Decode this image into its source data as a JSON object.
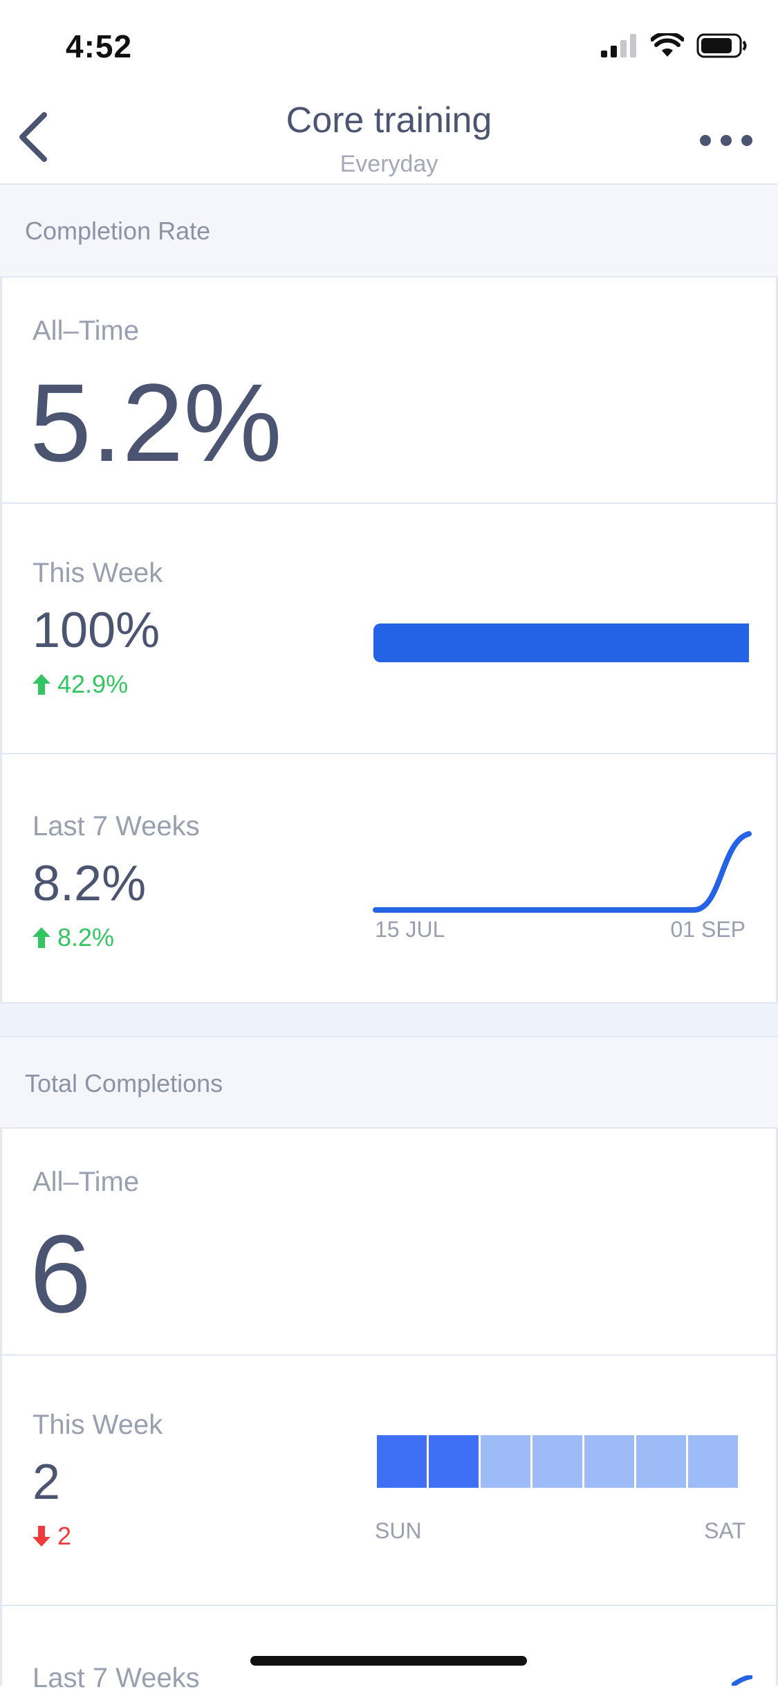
{
  "status_bar": {
    "time": "4:52"
  },
  "nav": {
    "title": "Core training",
    "subtitle": "Everyday"
  },
  "completion_rate": {
    "header": "Completion Rate",
    "all_time": {
      "label": "All–Time",
      "value": "5.2%"
    },
    "this_week": {
      "label": "This Week",
      "value": "100%",
      "delta": "42.9%",
      "delta_direction": "up",
      "bar_fill": 1.0
    },
    "last_7_weeks": {
      "label": "Last 7 Weeks",
      "value": "8.2%",
      "delta": "8.2%",
      "delta_direction": "up",
      "axis_start": "15 JUL",
      "axis_end": "01 SEP"
    }
  },
  "total_completions": {
    "header": "Total Completions",
    "all_time": {
      "label": "All–Time",
      "value": "6"
    },
    "this_week": {
      "label": "This Week",
      "value": "2",
      "delta": "2",
      "delta_direction": "down",
      "axis_start": "SUN",
      "axis_end": "SAT",
      "days_completed": [
        true,
        true,
        false,
        false,
        false,
        false,
        false
      ]
    },
    "last_7_weeks": {
      "label": "Last 7 Weeks"
    }
  },
  "colors": {
    "accent": "#2563e6",
    "done": "#3f6ff5",
    "undone": "#9dbbf7",
    "up": "#34c563",
    "down": "#ef3b3b"
  },
  "icons": {
    "back": "chevron-left-icon",
    "more": "more-dots-icon"
  }
}
